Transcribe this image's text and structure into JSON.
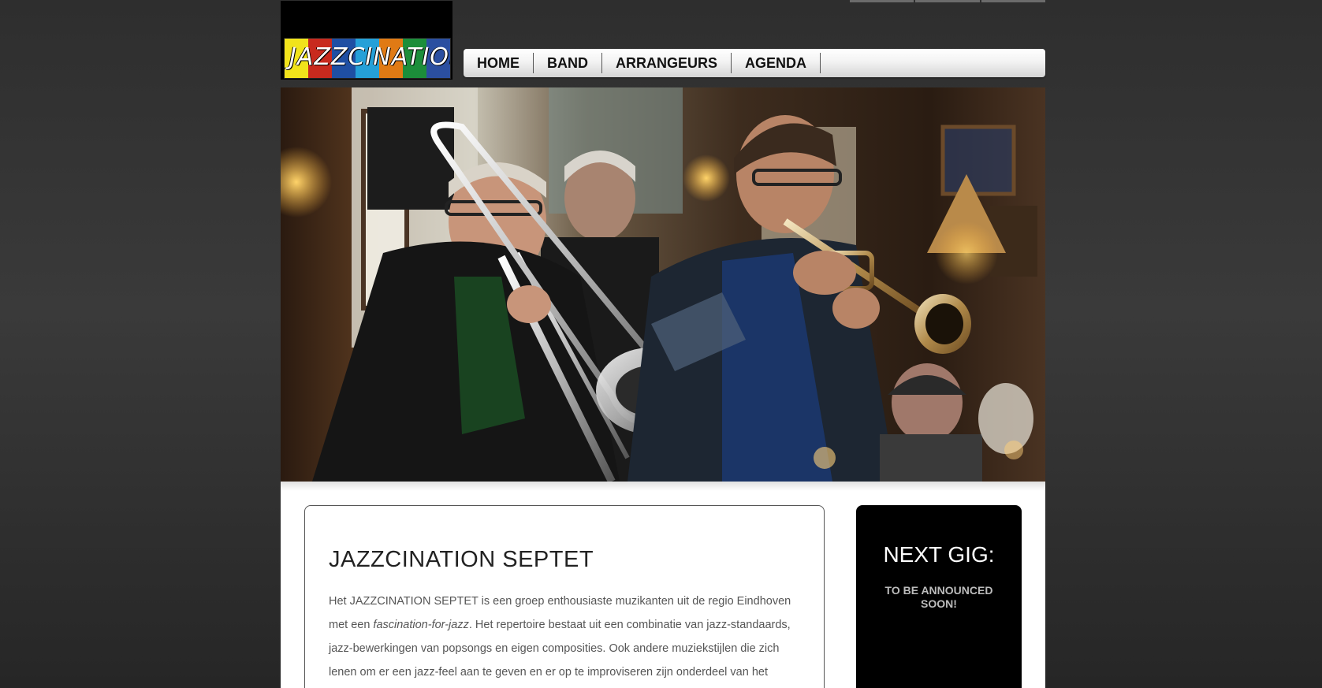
{
  "brand": {
    "logo_text": "JAZZCINATION",
    "logo_colors": [
      "#f1e31b",
      "#c82a1e",
      "#1f4fa3",
      "#25a0d8",
      "#e07a14",
      "#1c8e3a",
      "#2b4fa0"
    ]
  },
  "nav": {
    "items": [
      "HOME",
      "BAND",
      "ARRANGEURS",
      "AGENDA"
    ]
  },
  "hero": {
    "image_name": "band-photo"
  },
  "article": {
    "title": "JAZZCINATION SEPTET",
    "p1": "Het JAZZCINATION SEPTET is een groep enthousiaste muzikanten uit de regio Eindhoven met een ",
    "p1_em": "fascination-for-jazz",
    "p1_rest": ". Het repertoire bestaat uit een combinatie van jazz-standaards, jazz-bewerkingen van popsongs en eigen composities. Ook andere muziekstijlen die zich lenen om er een jazz-feel aan te geven en er op te improviseren zijn onderdeel van het"
  },
  "sidebar": {
    "title": "NEXT GIG:",
    "text": "TO BE ANNOUNCED SOON!"
  }
}
